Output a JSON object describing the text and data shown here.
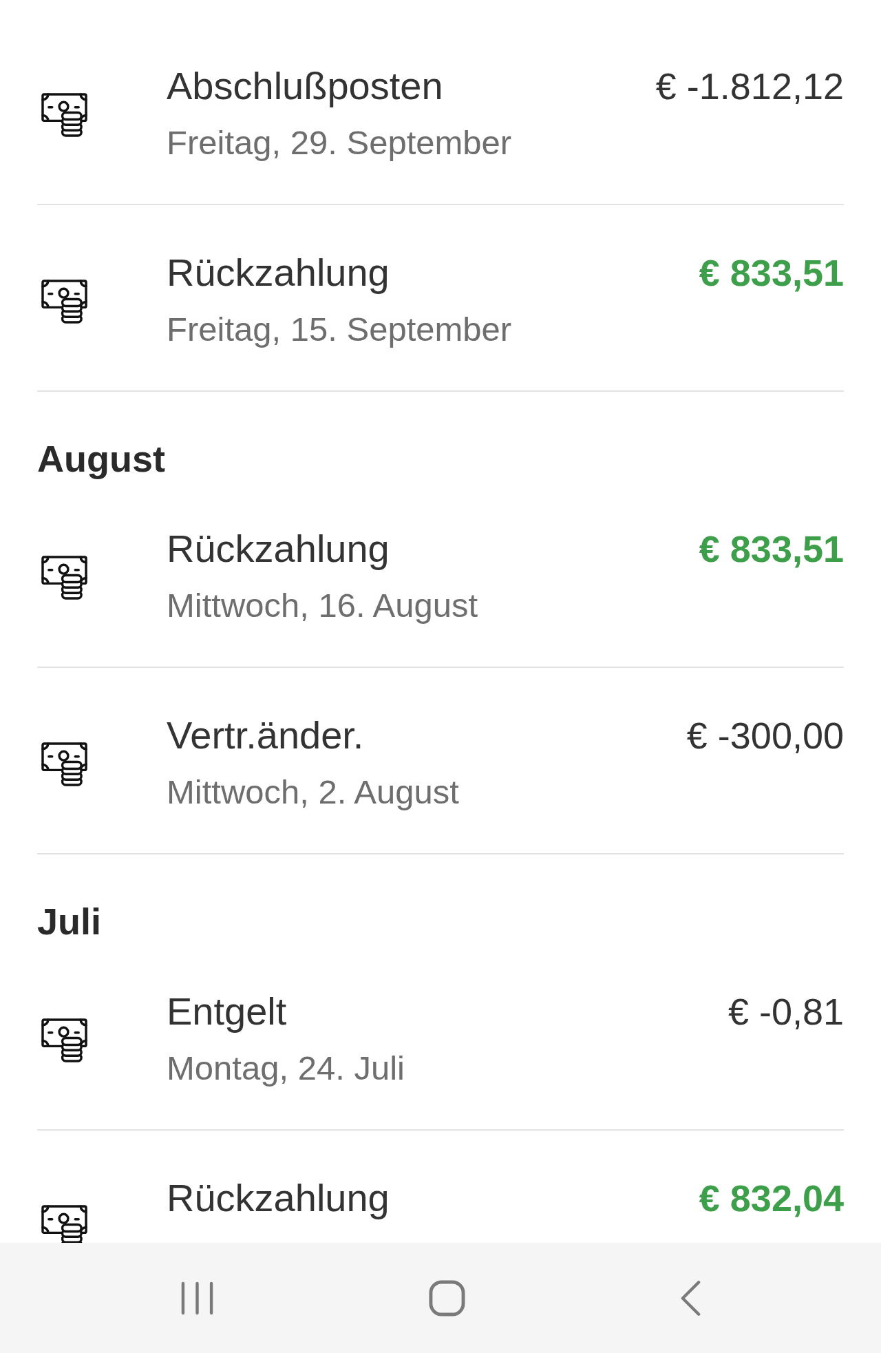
{
  "groups": [
    {
      "transactions": [
        {
          "title": "Abschlußposten",
          "date": "Freitag, 29. September",
          "amount": "€ -1.812,12",
          "kind": "debit"
        },
        {
          "title": "Rückzahlung",
          "date": "Freitag, 15. September",
          "amount": "€ 833,51",
          "kind": "credit"
        }
      ]
    },
    {
      "heading": "August",
      "transactions": [
        {
          "title": "Rückzahlung",
          "date": "Mittwoch, 16. August",
          "amount": "€ 833,51",
          "kind": "credit"
        },
        {
          "title": "Vertr.änder.",
          "date": "Mittwoch, 2. August",
          "amount": "€ -300,00",
          "kind": "debit"
        }
      ]
    },
    {
      "heading": "Juli",
      "transactions": [
        {
          "title": "Entgelt",
          "date": "Montag, 24. Juli",
          "amount": "€ -0,81",
          "kind": "debit"
        },
        {
          "title": "Rückzahlung",
          "amount": "€ 832,04",
          "kind": "credit"
        }
      ]
    }
  ]
}
